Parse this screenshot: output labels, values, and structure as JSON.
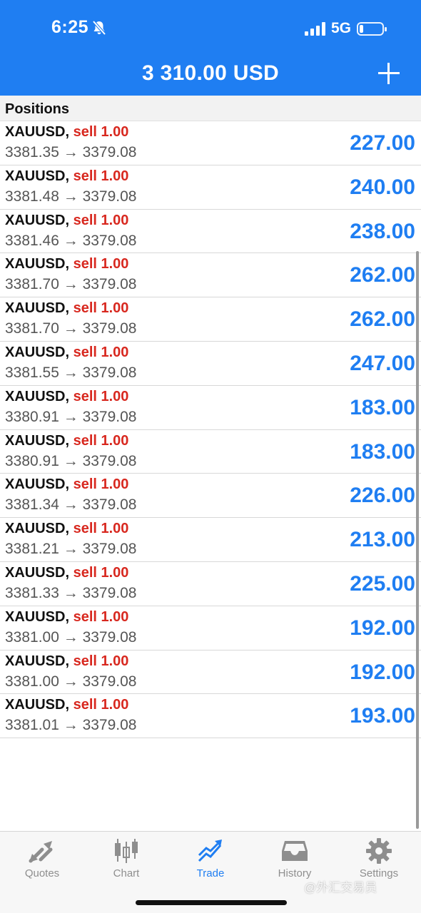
{
  "status_bar": {
    "time": "6:25",
    "network": "5G",
    "icons": [
      "bell-slash-icon",
      "signal-icon",
      "battery-icon"
    ]
  },
  "header": {
    "balance": "3 310.00 USD",
    "add_icon": "plus-icon"
  },
  "positions": {
    "title": "Positions",
    "rows": [
      {
        "symbol": "XAUUSD,",
        "side": "sell 1.00",
        "prices": "3381.35 → 3379.08",
        "profit": "227.00"
      },
      {
        "symbol": "XAUUSD,",
        "side": "sell 1.00",
        "prices": "3381.48 → 3379.08",
        "profit": "240.00"
      },
      {
        "symbol": "XAUUSD,",
        "side": "sell 1.00",
        "prices": "3381.46 → 3379.08",
        "profit": "238.00"
      },
      {
        "symbol": "XAUUSD,",
        "side": "sell 1.00",
        "prices": "3381.70 → 3379.08",
        "profit": "262.00"
      },
      {
        "symbol": "XAUUSD,",
        "side": "sell 1.00",
        "prices": "3381.70 → 3379.08",
        "profit": "262.00"
      },
      {
        "symbol": "XAUUSD,",
        "side": "sell 1.00",
        "prices": "3381.55 → 3379.08",
        "profit": "247.00"
      },
      {
        "symbol": "XAUUSD,",
        "side": "sell 1.00",
        "prices": "3380.91 → 3379.08",
        "profit": "183.00"
      },
      {
        "symbol": "XAUUSD,",
        "side": "sell 1.00",
        "prices": "3380.91 → 3379.08",
        "profit": "183.00"
      },
      {
        "symbol": "XAUUSD,",
        "side": "sell 1.00",
        "prices": "3381.34 → 3379.08",
        "profit": "226.00"
      },
      {
        "symbol": "XAUUSD,",
        "side": "sell 1.00",
        "prices": "3381.21 → 3379.08",
        "profit": "213.00"
      },
      {
        "symbol": "XAUUSD,",
        "side": "sell 1.00",
        "prices": "3381.33 → 3379.08",
        "profit": "225.00"
      },
      {
        "symbol": "XAUUSD,",
        "side": "sell 1.00",
        "prices": "3381.00 → 3379.08",
        "profit": "192.00"
      },
      {
        "symbol": "XAUUSD,",
        "side": "sell 1.00",
        "prices": "3381.00 → 3379.08",
        "profit": "192.00"
      },
      {
        "symbol": "XAUUSD,",
        "side": "sell 1.00",
        "prices": "3381.01 → 3379.08",
        "profit": "193.00"
      }
    ]
  },
  "tabs": [
    {
      "label": "Quotes",
      "icon": "quotes-arrows-icon",
      "active": false
    },
    {
      "label": "Chart",
      "icon": "candlestick-icon",
      "active": false
    },
    {
      "label": "Trade",
      "icon": "trade-trend-icon",
      "active": true
    },
    {
      "label": "History",
      "icon": "inbox-tray-icon",
      "active": false
    },
    {
      "label": "Settings",
      "icon": "gear-icon",
      "active": false
    }
  ],
  "watermark": "@外汇交易员",
  "colors": {
    "accent": "#1f7ef2",
    "sell": "#d8281f",
    "inactive_tab": "#8e8e8e"
  }
}
